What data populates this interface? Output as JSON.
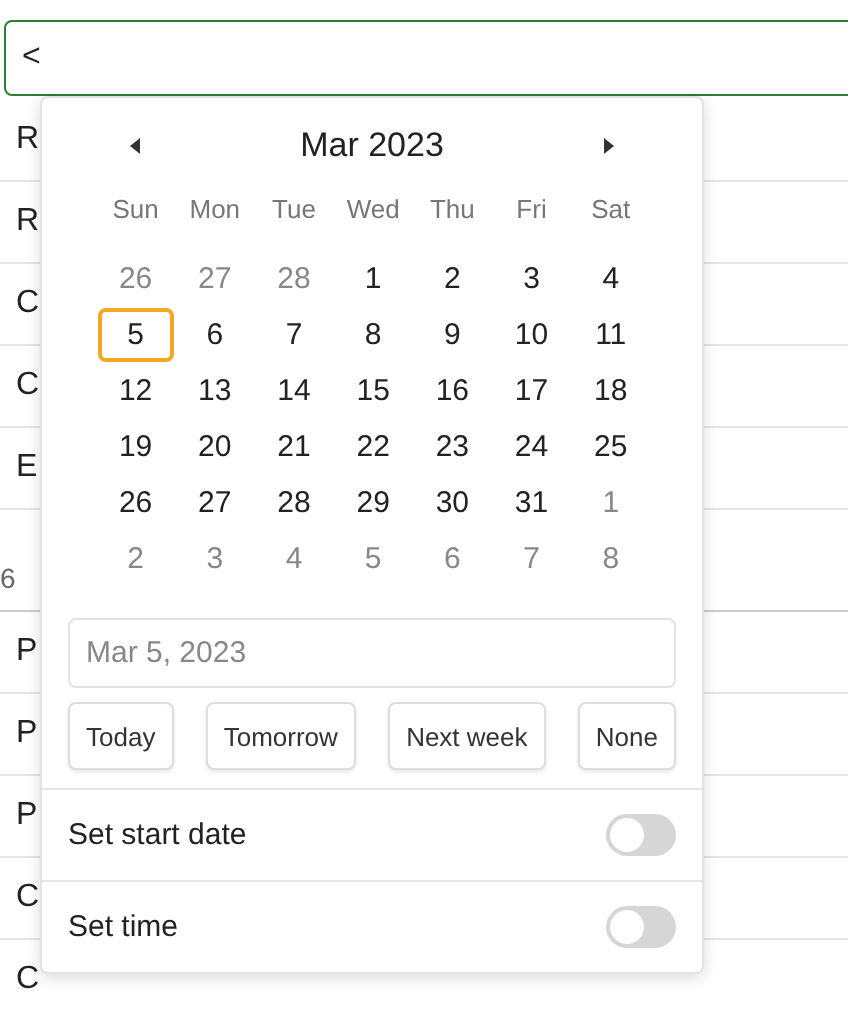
{
  "input": {
    "value": "<"
  },
  "list": [
    {
      "kind": "row",
      "label": "R"
    },
    {
      "kind": "row",
      "label": "R"
    },
    {
      "kind": "row",
      "label": "C"
    },
    {
      "kind": "row",
      "label": "C"
    },
    {
      "kind": "row",
      "label": "E"
    },
    {
      "kind": "header",
      "label": "6"
    },
    {
      "kind": "row",
      "label": "P"
    },
    {
      "kind": "row",
      "label": "P"
    },
    {
      "kind": "row",
      "label": "P"
    },
    {
      "kind": "row",
      "label": "C"
    },
    {
      "kind": "row",
      "label": "C"
    }
  ],
  "calendar": {
    "month": "Mar 2023",
    "weekdays": [
      "Sun",
      "Mon",
      "Tue",
      "Wed",
      "Thu",
      "Fri",
      "Sat"
    ],
    "weeks": [
      [
        {
          "label": "26",
          "muted": true,
          "selected": false
        },
        {
          "label": "27",
          "muted": true,
          "selected": false
        },
        {
          "label": "28",
          "muted": true,
          "selected": false
        },
        {
          "label": "1",
          "muted": false,
          "selected": false
        },
        {
          "label": "2",
          "muted": false,
          "selected": false
        },
        {
          "label": "3",
          "muted": false,
          "selected": false
        },
        {
          "label": "4",
          "muted": false,
          "selected": false
        }
      ],
      [
        {
          "label": "5",
          "muted": false,
          "selected": true
        },
        {
          "label": "6",
          "muted": false,
          "selected": false
        },
        {
          "label": "7",
          "muted": false,
          "selected": false
        },
        {
          "label": "8",
          "muted": false,
          "selected": false
        },
        {
          "label": "9",
          "muted": false,
          "selected": false
        },
        {
          "label": "10",
          "muted": false,
          "selected": false
        },
        {
          "label": "11",
          "muted": false,
          "selected": false
        }
      ],
      [
        {
          "label": "12",
          "muted": false,
          "selected": false
        },
        {
          "label": "13",
          "muted": false,
          "selected": false
        },
        {
          "label": "14",
          "muted": false,
          "selected": false
        },
        {
          "label": "15",
          "muted": false,
          "selected": false
        },
        {
          "label": "16",
          "muted": false,
          "selected": false
        },
        {
          "label": "17",
          "muted": false,
          "selected": false
        },
        {
          "label": "18",
          "muted": false,
          "selected": false
        }
      ],
      [
        {
          "label": "19",
          "muted": false,
          "selected": false
        },
        {
          "label": "20",
          "muted": false,
          "selected": false
        },
        {
          "label": "21",
          "muted": false,
          "selected": false
        },
        {
          "label": "22",
          "muted": false,
          "selected": false
        },
        {
          "label": "23",
          "muted": false,
          "selected": false
        },
        {
          "label": "24",
          "muted": false,
          "selected": false
        },
        {
          "label": "25",
          "muted": false,
          "selected": false
        }
      ],
      [
        {
          "label": "26",
          "muted": false,
          "selected": false
        },
        {
          "label": "27",
          "muted": false,
          "selected": false
        },
        {
          "label": "28",
          "muted": false,
          "selected": false
        },
        {
          "label": "29",
          "muted": false,
          "selected": false
        },
        {
          "label": "30",
          "muted": false,
          "selected": false
        },
        {
          "label": "31",
          "muted": false,
          "selected": false
        },
        {
          "label": "1",
          "muted": true,
          "selected": false
        }
      ],
      [
        {
          "label": "2",
          "muted": true,
          "selected": false
        },
        {
          "label": "3",
          "muted": true,
          "selected": false
        },
        {
          "label": "4",
          "muted": true,
          "selected": false
        },
        {
          "label": "5",
          "muted": true,
          "selected": false
        },
        {
          "label": "6",
          "muted": true,
          "selected": false
        },
        {
          "label": "7",
          "muted": true,
          "selected": false
        },
        {
          "label": "8",
          "muted": true,
          "selected": false
        }
      ]
    ]
  },
  "date_field": {
    "placeholder": "Mar 5, 2023"
  },
  "quick_buttons": [
    "Today",
    "Tomorrow",
    "Next week",
    "None"
  ],
  "toggles": [
    {
      "label": "Set start date",
      "on": false
    },
    {
      "label": "Set time",
      "on": false
    }
  ]
}
